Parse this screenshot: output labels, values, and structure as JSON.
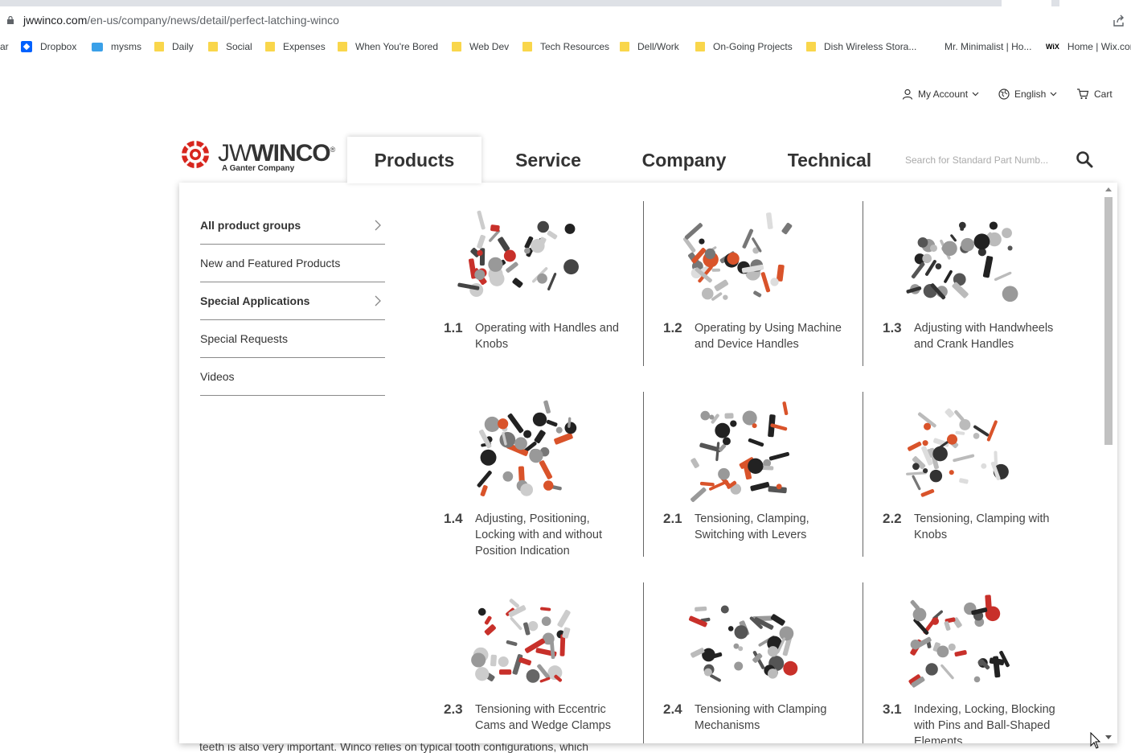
{
  "browser": {
    "url_host": "jwwinco.com",
    "url_path": "/en-us/company/news/detail/perfect-latching-winco",
    "bookmarks": [
      {
        "label": "ar",
        "icon": "none"
      },
      {
        "label": "Dropbox",
        "icon": "dropbox-icon"
      },
      {
        "label": "mysms",
        "icon": "mysms-icon"
      },
      {
        "label": "Daily",
        "icon": "folder-icon"
      },
      {
        "label": "Social",
        "icon": "folder-icon"
      },
      {
        "label": "Expenses",
        "icon": "folder-icon"
      },
      {
        "label": "When You're Bored",
        "icon": "folder-icon"
      },
      {
        "label": "Web Dev",
        "icon": "folder-icon"
      },
      {
        "label": "Tech Resources",
        "icon": "folder-icon"
      },
      {
        "label": "Dell/Work",
        "icon": "folder-icon"
      },
      {
        "label": "On-Going Projects",
        "icon": "folder-icon"
      },
      {
        "label": "Dish Wireless Stora...",
        "icon": "folder-icon"
      },
      {
        "label": "Mr. Minimalist | Ho...",
        "icon": "none"
      },
      {
        "label": "Home | Wix.com",
        "icon": "wix-icon"
      }
    ]
  },
  "header": {
    "my_account": "My Account",
    "language": "English",
    "cart": "Cart",
    "logo_wordmark_light": "JW",
    "logo_wordmark_bold": "WINCO",
    "logo_reg": "®",
    "logo_sub": "A Ganter Company",
    "nav": [
      "Products",
      "Service",
      "Company",
      "Technical"
    ],
    "search_placeholder": "Search for Standard Part Numb..."
  },
  "dropdown": {
    "menu": [
      {
        "label": "All product groups",
        "bold": true,
        "arrow": true
      },
      {
        "label": "New and Featured Products",
        "bold": false,
        "arrow": false
      },
      {
        "label": "Special Applications",
        "bold": true,
        "arrow": true
      },
      {
        "label": "Special Requests",
        "bold": false,
        "arrow": false
      },
      {
        "label": "Videos",
        "bold": false,
        "arrow": false
      }
    ],
    "groups": [
      {
        "num": "1.1",
        "title": "Operating with Handles and Knobs"
      },
      {
        "num": "1.2",
        "title": "Operating by Using Machine\nand Device Handles"
      },
      {
        "num": "1.3",
        "title": "Adjusting with Handwheels and Crank Handles"
      },
      {
        "num": "1.4",
        "title": "Adjusting, Positioning, Locking with and without Position Indication"
      },
      {
        "num": "2.1",
        "title": "Tensioning, Clamping, Switching with Levers"
      },
      {
        "num": "2.2",
        "title": "Tensioning, Clamping with Knobs"
      },
      {
        "num": "2.3",
        "title": "Tensioning with Eccentric Cams and Wedge Clamps"
      },
      {
        "num": "2.4",
        "title": "Tensioning with Clamping Mechanisms"
      },
      {
        "num": "3.1",
        "title": "Indexing, Locking, Blocking with Pins and Ball-Shaped Elements"
      }
    ]
  },
  "page": {
    "behind_text": "teeth is also very important. Winco relies on typical tooth configurations, which"
  },
  "colors": {
    "brand_red": "#d7261e",
    "text": "#333333",
    "folder": "#f9d64b"
  }
}
